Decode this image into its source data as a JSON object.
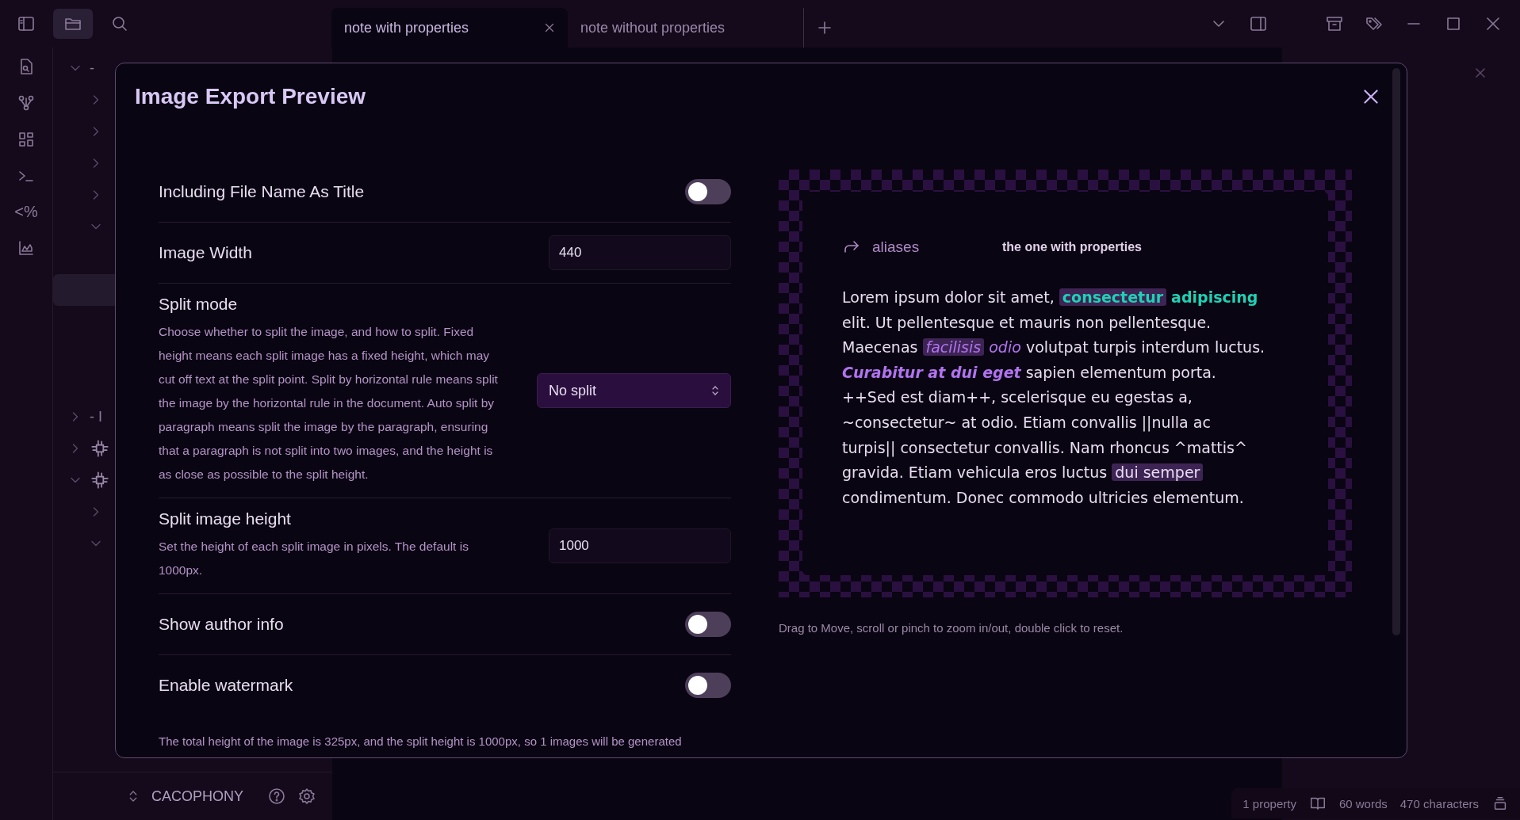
{
  "tabs": [
    {
      "title": "note with properties",
      "selected": true
    },
    {
      "title": "note without properties",
      "selected": false
    }
  ],
  "ribbon": [
    {
      "kind": "file-search"
    },
    {
      "kind": "graph"
    },
    {
      "kind": "grid"
    },
    {
      "kind": "terminal"
    },
    {
      "kind": "text",
      "label": "<%"
    },
    {
      "kind": "chart"
    }
  ],
  "explorer": [
    {
      "label": "-",
      "expanded": true,
      "children": [
        {
          "expanded": false
        },
        {
          "expanded": false
        },
        {
          "expanded": false
        },
        {
          "expanded": false
        },
        {
          "expanded": true,
          "children": [
            {
              "selected": false
            },
            {
              "selected": true
            },
            {
              "selected": false
            },
            {
              "selected": false
            },
            {
              "selected": false
            }
          ]
        }
      ]
    },
    {
      "label": "- I",
      "expanded": false
    },
    {
      "kind": "circuit",
      "expanded": false
    },
    {
      "kind": "circuit",
      "expanded": true,
      "children": [
        {
          "expanded": false
        },
        {
          "expanded": true
        }
      ]
    }
  ],
  "vault": {
    "name": "CACOPHONY"
  },
  "modal": {
    "title": "Image Export Preview",
    "settings": [
      {
        "kind": "toggle",
        "name": "Including File Name As Title",
        "on": false
      },
      {
        "kind": "input",
        "name": "Image Width",
        "value": "440"
      },
      {
        "kind": "select",
        "name": "Split mode",
        "description": "Choose whether to split the image, and how to split. Fixed height means each split image has a fixed height, which may cut off text at the split point. Split by horizontal rule means split the image by the horizontal rule in the document. Auto split by paragraph means split the image by the paragraph, ensuring that a paragraph is not split into two images, and the height is as close as possible to the split height.",
        "value": "No split"
      },
      {
        "kind": "input",
        "name": "Split image height",
        "description": "Set the height of each split image in pixels. The default is 1000px.",
        "value": "1000"
      },
      {
        "kind": "toggle",
        "name": "Show author info",
        "on": false
      },
      {
        "kind": "toggle",
        "name": "Enable watermark",
        "on": false
      }
    ],
    "summary": "The total height of the image is 325px, and the split height is 1000px, so 1 images will be generated",
    "preview": {
      "property": {
        "key": "aliases",
        "value": "the one with properties"
      },
      "paragraph": [
        {
          "text": "Lorem ipsum dolor sit amet, ",
          "highlight": false,
          "strong": false
        },
        {
          "text": "**consectetur**",
          "highlight": true,
          "strong": false
        },
        {
          "text": " **adipiscing** elit. Ut pellentesque et mauris non pellentesque. Maecenas ",
          "highlight": false,
          "strong": false
        },
        {
          "text": "*facilisis*",
          "highlight": true,
          "strong": false
        },
        {
          "text": " *odio* volutpat turpis interdum luctus. ",
          "highlight": false,
          "strong": false
        },
        {
          "text": "*Curabitur at dui eget*",
          "highlight": false,
          "strong": true
        },
        {
          "text": " sapien elementum porta. ++Sed est diam++, scelerisque eu egestas a, ~consectetur~ at odio. Etiam convallis ||nulla ac turpis|| consectetur convallis. Nam rhoncus ^mattis^ gravida. Etiam vehicula eros luctus ",
          "highlight": false,
          "strong": false
        },
        {
          "text": "dui semper",
          "highlight": true,
          "strong": false
        },
        {
          "text": " condimentum. Donec commodo ultricies elementum.",
          "highlight": false,
          "strong": false
        }
      ]
    },
    "hint": "Drag to Move, scroll or pinch to zoom in/out, double click to reset."
  },
  "status_bar": {
    "properties": "1 property",
    "words": "60 words",
    "characters": "470 characters"
  }
}
